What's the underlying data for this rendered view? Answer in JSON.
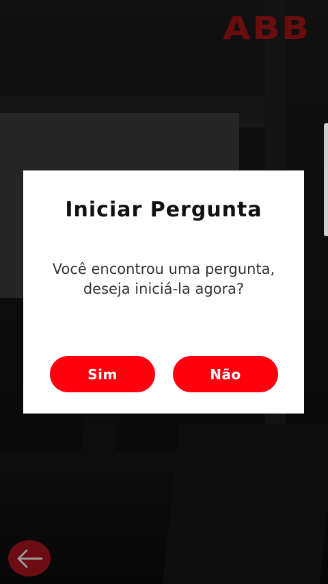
{
  "brand": {
    "logo_text": "ABB"
  },
  "dialog": {
    "title": "Iniciar Pergunta",
    "message": "Você encontrou uma pergunta, deseja iniciá-la agora?",
    "yes_label": "Sim",
    "no_label": "Não"
  },
  "nav": {
    "back_icon": "arrow-left-icon"
  },
  "colors": {
    "accent": "#ff000f",
    "dialog_bg": "#ffffff",
    "logo": "#6a0d0d",
    "back_button": "#6b0d12"
  }
}
